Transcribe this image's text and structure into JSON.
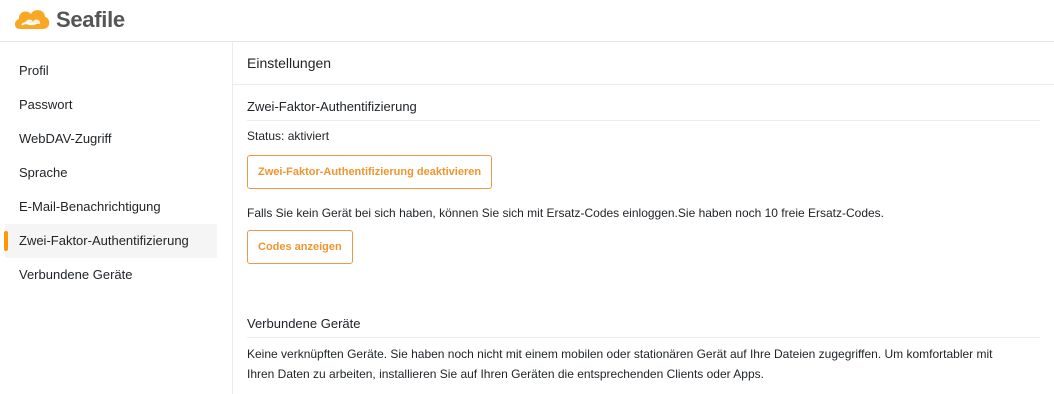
{
  "app": {
    "brand": "Seafile",
    "accent_color": "#ff9800"
  },
  "sidebar": {
    "items": [
      {
        "label": "Profil"
      },
      {
        "label": "Passwort"
      },
      {
        "label": "WebDAV-Zugriff"
      },
      {
        "label": "Sprache"
      },
      {
        "label": "E-Mail-Benachrichtigung"
      },
      {
        "label": "Zwei-Faktor-Authentifizierung",
        "active": true
      },
      {
        "label": "Verbundene Geräte"
      }
    ]
  },
  "main": {
    "title": "Einstellungen",
    "two_factor": {
      "heading": "Zwei-Faktor-Authentifizierung",
      "status": "Status: aktiviert",
      "disable_button": "Zwei-Faktor-Authentifizierung deaktivieren",
      "backup_text": "Falls Sie kein Gerät bei sich haben, können Sie sich mit Ersatz-Codes einloggen.Sie haben noch 10 freie Ersatz-Codes.",
      "show_codes_button": "Codes anzeigen"
    },
    "devices": {
      "heading": "Verbundene Geräte",
      "text_line1": "Keine verknüpften Geräte. Sie haben noch nicht mit einem mobilen oder stationären Gerät auf Ihre Dateien zugegriffen. Um komfortabler mit",
      "text_line2": "Ihren Daten zu arbeiten, installieren Sie auf Ihren Geräten die entsprechenden Clients oder Apps."
    }
  }
}
